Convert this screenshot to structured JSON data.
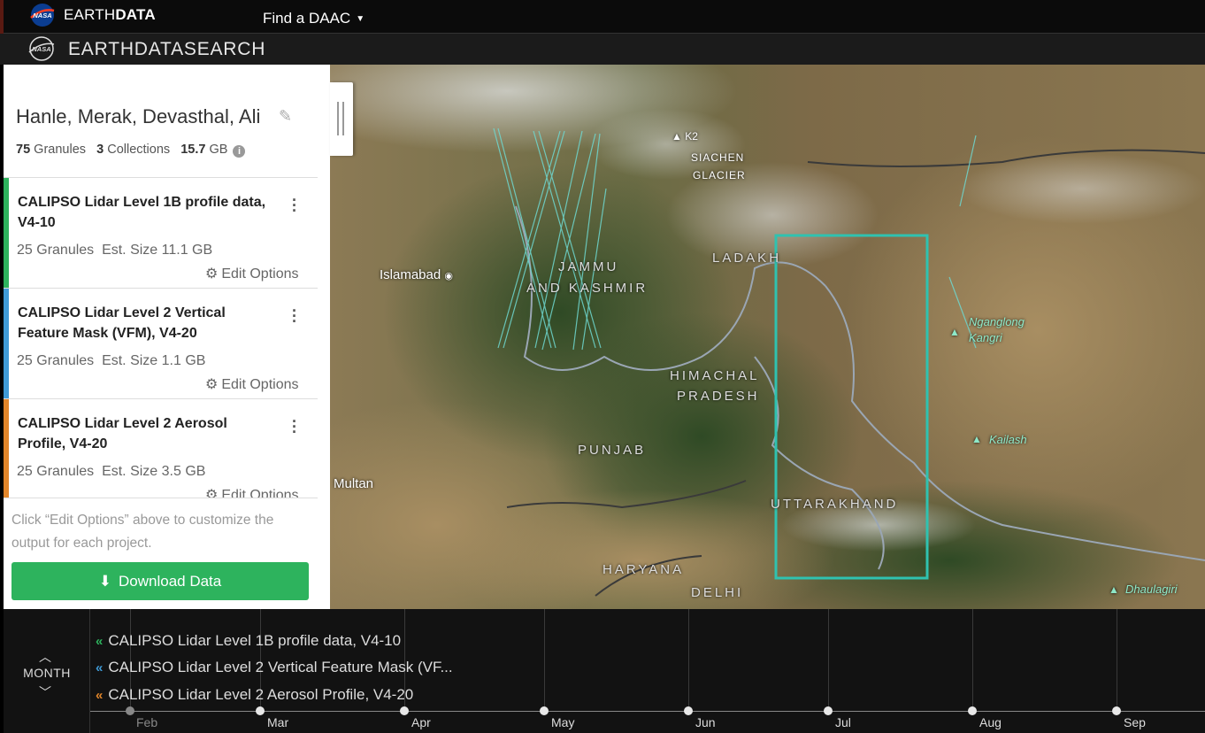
{
  "header": {
    "brand_prefix": "EARTH",
    "brand_suffix": "DATA",
    "find_daac": "Find a DAAC",
    "app_title_prefix": "EARTHDATA",
    "app_title_suffix": "SEARCH",
    "nasa_logo_text": "NASA"
  },
  "project": {
    "title": "Hanle, Merak, Devasthal, Ali",
    "granules_count": "75",
    "granules_label": "Granules",
    "collections_count": "3",
    "collections_label": "Collections",
    "size_value": "15.7",
    "size_unit": "GB"
  },
  "collections": [
    {
      "title": "CALIPSO Lidar Level 1B profile data, V4-10",
      "granules": "25 Granules",
      "size": "Est. Size 11.1 GB",
      "options": "Edit Options",
      "color": "#2db35d"
    },
    {
      "title": "CALIPSO Lidar Level 2 Vertical Feature Mask (VFM), V4-20",
      "granules": "25 Granules",
      "size": "Est. Size 1.1 GB",
      "options": "Edit Options",
      "color": "#3f9ad6"
    },
    {
      "title": "CALIPSO Lidar Level 2 Aerosol Profile, V4-20",
      "granules": "25 Granules",
      "size": "Est. Size 3.5 GB",
      "options": "Edit Options",
      "color": "#e2862a"
    }
  ],
  "footer": {
    "note": "Click “Edit Options” above to customize the output for each project.",
    "download_label": "Download Data"
  },
  "map_labels": {
    "siachen": "SIACHEN",
    "glacier": "GLACIER",
    "k2": "K2",
    "ladakh": "LADAKH",
    "jammu": "JAMMU",
    "kashmir": "AND KASHMIR",
    "islamabad": "Islamabad",
    "himachal": "HIMACHAL",
    "pradesh": "PRADESH",
    "punjab": "PUNJAB",
    "uttarakhand": "UTTARAKHAND",
    "haryana": "HARYANA",
    "delhi": "DELHI",
    "multan": "Multan",
    "nganglong": "Nganglong",
    "kangri": "Kangri",
    "kailash": "Kailash",
    "dhaulagiri": "Dhaulagiri"
  },
  "timeline": {
    "zoom_label": "MONTH",
    "tracks": [
      {
        "label": "CALIPSO Lidar Level 1B profile data, V4-10",
        "color": "#2db35d"
      },
      {
        "label": "CALIPSO Lidar Level 2 Vertical Feature Mask (VF...",
        "color": "#3f9ad6"
      },
      {
        "label": "CALIPSO Lidar Level 2 Aerosol Profile, V4-20",
        "color": "#e2862a"
      }
    ],
    "months": [
      "Feb",
      "Mar",
      "Apr",
      "May",
      "Jun",
      "Jul",
      "Aug",
      "Sep"
    ]
  },
  "colors": {
    "accent_green": "#2db35d",
    "selection_box": "#2fc2b0",
    "granule_track": "#6fd8d0"
  }
}
